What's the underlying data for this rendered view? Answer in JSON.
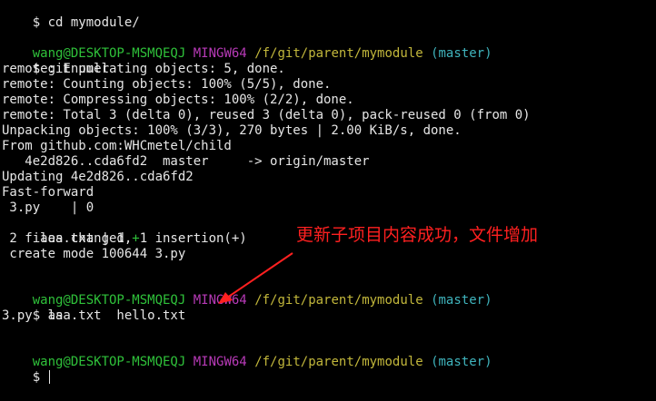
{
  "terminal": {
    "cmd_cd": "$ cd mymodule/",
    "prompt_user": "wang@DESKTOP-MSMQEQJ",
    "prompt_system": "MINGW64",
    "prompt_path": "/f/git/parent/mymodule",
    "prompt_branch": "(master)",
    "cmd_git_pull": "$ git pull",
    "out_enumerating": "remote: Enumerating objects: 5, done.",
    "out_counting": "remote: Counting objects: 100% (5/5), done.",
    "out_compressing": "remote: Compressing objects: 100% (2/2), done.",
    "out_total": "remote: Total 3 (delta 0), reused 3 (delta 0), pack-reused 0 (from 0)",
    "out_unpacking": "Unpacking objects: 100% (3/3), 270 bytes | 2.00 KiB/s, done.",
    "out_from": "From github.com:WHCmetel/child",
    "out_ref_update": "   4e2d826..cda6fd2  master     -> origin/master",
    "out_updating": "Updating 4e2d826..cda6fd2",
    "out_fast_forward": "Fast-forward",
    "out_file1": " 3.py    | 0",
    "out_file2_prefix": " aaa.txt | 1 ",
    "out_file2_plus": "+",
    "out_summary": " 2 files changed, 1 insertion(+)",
    "out_create": " create mode 100644 3.py",
    "cmd_ls": "$ ls",
    "out_ls": "3.py  aaa.txt  hello.txt",
    "cmd_final": "$ "
  },
  "annotation": {
    "text": "更新子项目内容成功，文件增加",
    "color": "#ff2020"
  },
  "colors": {
    "background": "#000000",
    "text": "#e6e6e6",
    "user": "#2fc13a",
    "system": "#b83ab8",
    "path": "#c2b73b",
    "branch": "#3fb4bd"
  }
}
